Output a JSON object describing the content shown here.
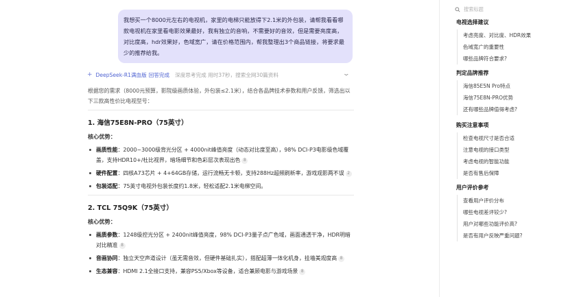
{
  "user_message": "我想买一个8000元左右的电视机，家里的电梯只能放得下2.1米的外包装，请帮我看看哪款电视机在家里看电影效果最好，我有独立的音响，不需要好的音效，但是需要亮度高，对比度高，hdr效果好，色域宽广，请在价格范围内，帮我整理出3个商品链接，将要求最少的推荐给我。",
  "thinking": {
    "icon": "plus-icon",
    "model": "DeepSeek-R1满血版",
    "status": "回答完成",
    "detail": "深度思考完成 用时37秒，搜索全网30篇资料",
    "chevron": "chevron-down-icon"
  },
  "answer": {
    "intro": "根据您的需求（8000元预算，影院级画质体验，外包装≤2.1米），结合各品牌技术参数和用户反馈，筛选出以下三款高性价比电视型号：",
    "products": [
      {
        "title": "1. 海信75E8N-PRO（75英寸）",
        "sub": "核心优势：",
        "points": [
          {
            "key": "画质性能",
            "text": "：2000~3000级背光分区 + 4000nit峰值亮度（动态对比度至高），98% DCI-P3电影级色域覆盖，支持HDR10+/杜比视界，暗场细节和色彩层次表现出色",
            "cite": "8"
          },
          {
            "key": "硬件配置",
            "text": "：四核A73芯片 + 4+64GB存储，运行流畅无卡顿，支持288Hz超频刷新率，游戏观影两不误",
            "cite": "2"
          },
          {
            "key": "包装适配",
            "text": "：75英寸电视外包装长度约1.8米，轻松适配2.1米电梯空间。",
            "cite": ""
          }
        ]
      },
      {
        "title": "2. TCL 75Q9K（75英寸）",
        "sub": "核心优势：",
        "points": [
          {
            "key": "画质参数",
            "text": "：1248级控光分区 + 2400nit峰值亮度，98% DCI-P3量子点广色域，画面通透干净，HDR明暗对比精准",
            "cite": "8"
          },
          {
            "key": "音画协同",
            "text": "：独立天空声道设计（虽无需音效，但硬件基础扎实），搭配超薄一体化机身，挂墙美观度高",
            "cite": "8"
          },
          {
            "key": "生态兼容",
            "text": "：HDMI 2.1全接口支持，兼容PS5/Xbox等设备，适合兼顾电影与游戏场景",
            "cite": "8"
          }
        ]
      }
    ]
  },
  "outline": {
    "search_placeholder": "搜索标题",
    "search_icon": "search-icon",
    "sections": [
      {
        "title": "电视选择建议",
        "items": [
          "考虑亮度、对比度、HDR效果",
          "色域宽广的重要性",
          "哪些品牌符合要求?"
        ]
      },
      {
        "title": "判定品牌推荐",
        "items": [
          "海信85E5N Pro特点",
          "海信75E8N-PRO优势",
          "还有哪些品牌值得考虑?"
        ]
      },
      {
        "title": "购买注意事项",
        "items": [
          "检查电视尺寸是否合适",
          "注意电视的接口类型",
          "考虑电视的智能功能",
          "是否有售后保障"
        ]
      },
      {
        "title": "用户评价参考",
        "items": [
          "查看用户评价分布",
          "哪些电视差评较少?",
          "用户对哪些功能评价高?",
          "是否有用户反映严重问题?"
        ]
      }
    ]
  }
}
